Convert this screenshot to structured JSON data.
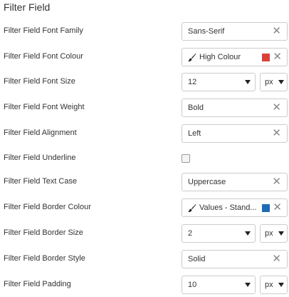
{
  "section_title": "Filter Field",
  "rows": {
    "font_family": {
      "label": "Filter Field Font Family",
      "value": "Sans-Serif",
      "clear": "✕"
    },
    "font_colour": {
      "label": "Filter Field Font Colour",
      "value": "High Colour",
      "swatch_color": "#d9413a",
      "icon": "paint-brush-icon",
      "clear": "✕"
    },
    "font_size": {
      "label": "Filter Field Font Size",
      "value": "12",
      "unit": "px"
    },
    "font_weight": {
      "label": "Filter Field Font Weight",
      "value": "Bold",
      "clear": "✕"
    },
    "alignment": {
      "label": "Filter Field Alignment",
      "value": "Left",
      "clear": "✕"
    },
    "underline": {
      "label": "Filter Field Underline",
      "checked": false
    },
    "text_case": {
      "label": "Filter Field Text Case",
      "value": "Uppercase",
      "clear": "✕"
    },
    "border_colour": {
      "label": "Filter Field Border Colour",
      "value": "Values - Stand...",
      "swatch_color": "#1a6cb5",
      "icon": "paint-brush-icon",
      "clear": "✕"
    },
    "border_size": {
      "label": "Filter Field Border Size",
      "value": "2",
      "unit": "px"
    },
    "border_style": {
      "label": "Filter Field Border Style",
      "value": "Solid",
      "clear": "✕"
    },
    "padding": {
      "label": "Filter Field Padding",
      "value": "10",
      "unit": "px"
    }
  }
}
